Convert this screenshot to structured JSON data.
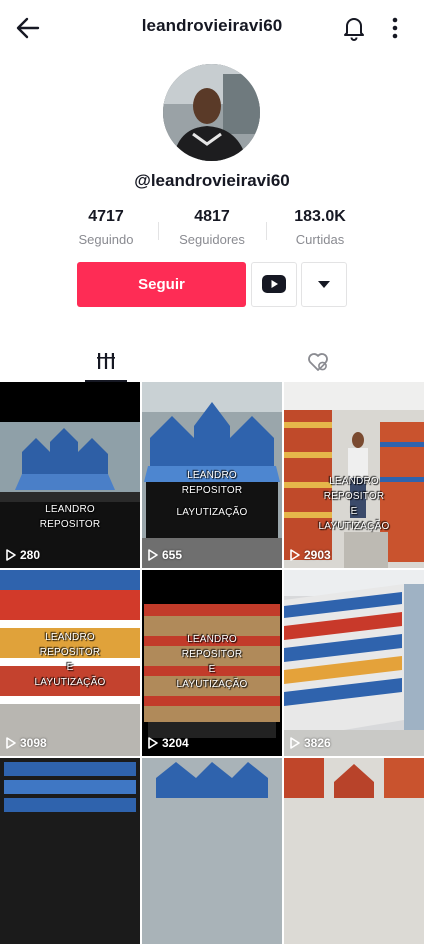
{
  "header": {
    "title": "leandrovieiravi60"
  },
  "profile": {
    "handle": "@leandrovieiravi60"
  },
  "stats": [
    {
      "value": "4717",
      "label": "Seguindo"
    },
    {
      "value": "4817",
      "label": "Seguidores"
    },
    {
      "value": "183.0K",
      "label": "Curtidas"
    }
  ],
  "actions": {
    "follow_label": "Seguir"
  },
  "icons": {
    "back": "arrow-left-icon",
    "bell": "bell-icon",
    "more": "kebab-icon",
    "youtube": "youtube-icon",
    "dropdown": "caret-down-icon",
    "videos_tab": "grid-icon",
    "liked_tab": "heart-hidden-icon",
    "play": "play-icon"
  },
  "colors": {
    "accent": "#fe2c55",
    "text": "#161823",
    "muted": "#8a8b91"
  },
  "videos": [
    {
      "views": "280",
      "caption": [
        "LEANDRO",
        "REPOSITOR"
      ]
    },
    {
      "views": "655",
      "caption": [
        "LEANDRO",
        "REPOSITOR",
        "",
        "LAYUTIZAÇÃO"
      ]
    },
    {
      "views": "2903",
      "caption": [
        "LEANDRO",
        "REPOSITOR",
        "E",
        "LAYUTIZAÇÃO"
      ]
    },
    {
      "views": "3098",
      "caption": [
        "LEANDRO",
        "REPOSITOR",
        "E",
        "LAYUTIZAÇÃO"
      ]
    },
    {
      "views": "3204",
      "caption": [
        "LEANDRO",
        "REPOSITOR",
        "E",
        "LAYUTIZAÇÃO"
      ]
    },
    {
      "views": "3826",
      "caption": []
    },
    {
      "views": "",
      "caption": []
    },
    {
      "views": "",
      "caption": []
    },
    {
      "views": "",
      "caption": []
    }
  ]
}
